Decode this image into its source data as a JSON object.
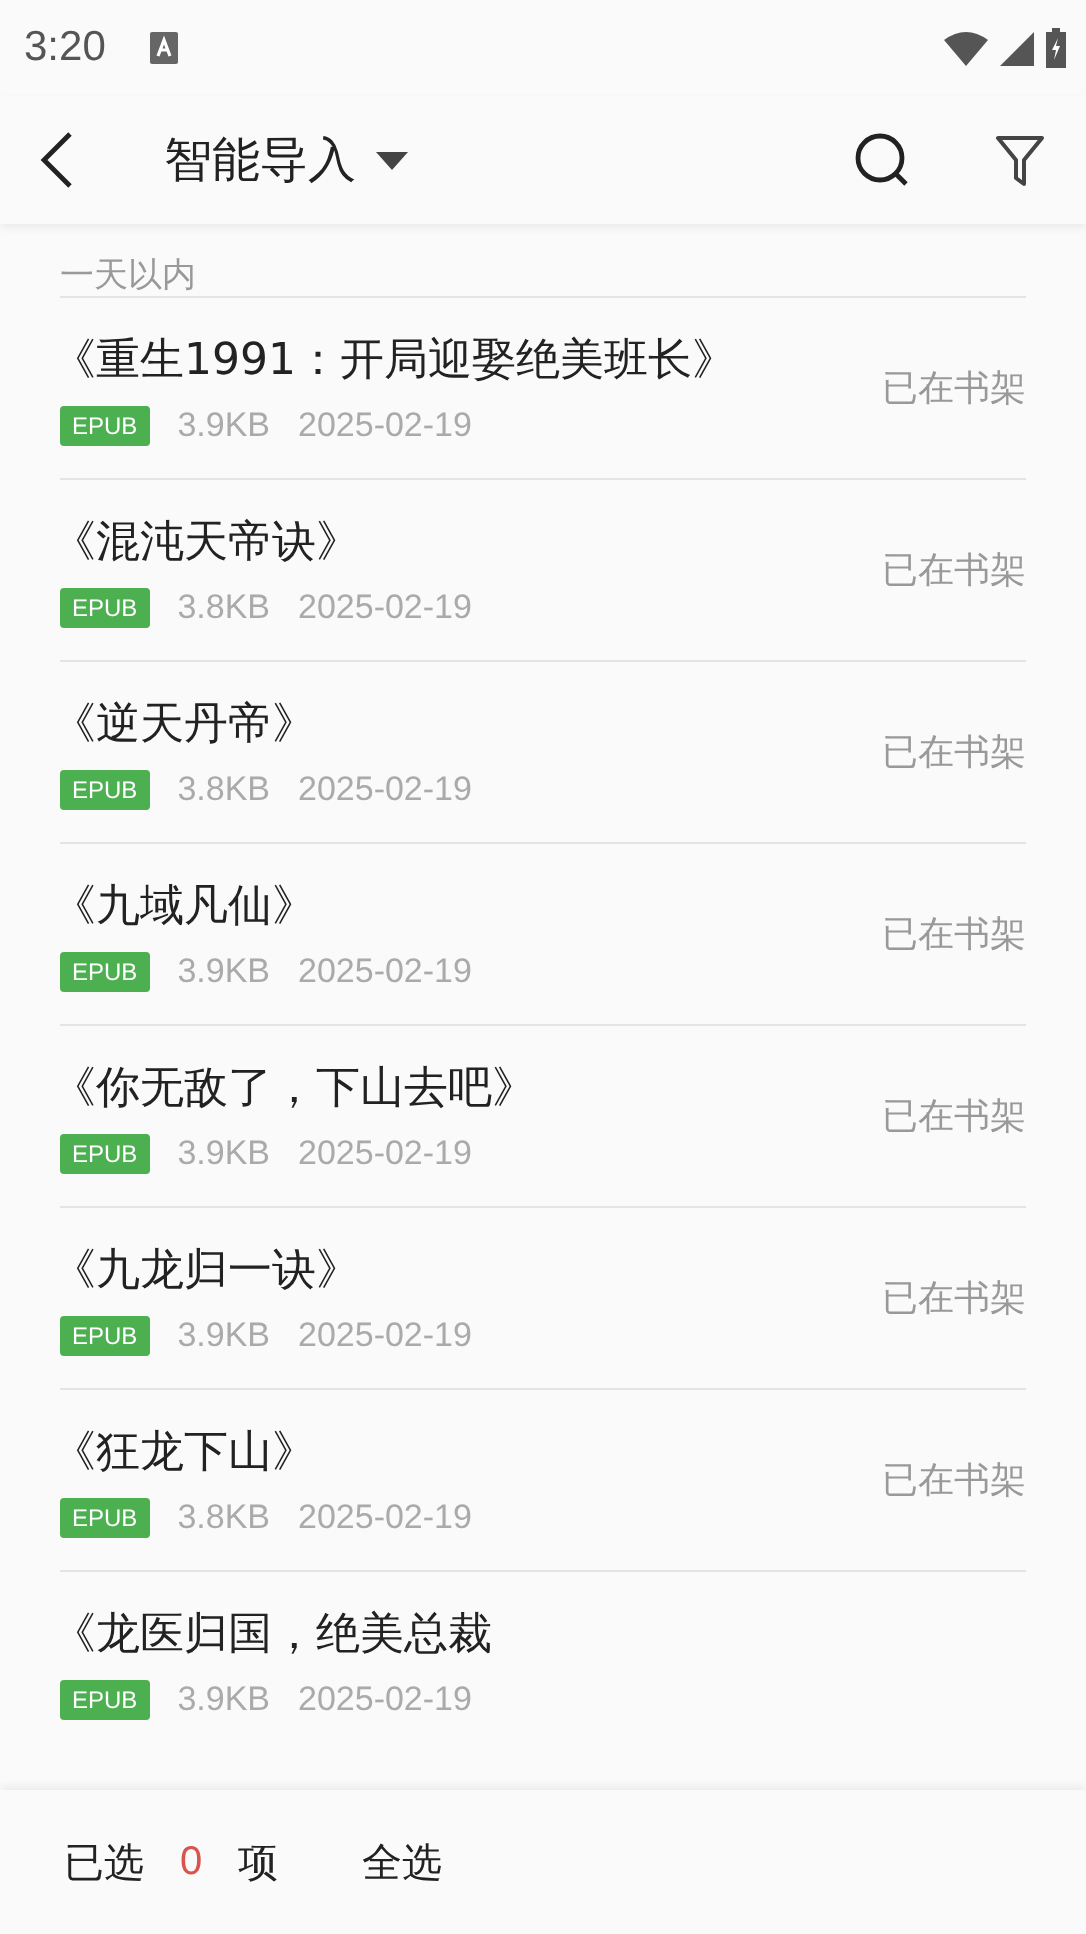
{
  "status_bar": {
    "time": "3:20"
  },
  "app_bar": {
    "title": "智能导入"
  },
  "section": {
    "title": "一天以内"
  },
  "books": [
    {
      "title": "《重生1991：开局迎娶绝美班长》",
      "format": "EPUB",
      "size": "3.9KB",
      "date": "2025-02-19",
      "status": "已在书架"
    },
    {
      "title": "《混沌天帝诀》",
      "format": "EPUB",
      "size": "3.8KB",
      "date": "2025-02-19",
      "status": "已在书架"
    },
    {
      "title": "《逆天丹帝》",
      "format": "EPUB",
      "size": "3.8KB",
      "date": "2025-02-19",
      "status": "已在书架"
    },
    {
      "title": "《九域凡仙》",
      "format": "EPUB",
      "size": "3.9KB",
      "date": "2025-02-19",
      "status": "已在书架"
    },
    {
      "title": "《你无敌了，下山去吧》",
      "format": "EPUB",
      "size": "3.9KB",
      "date": "2025-02-19",
      "status": "已在书架"
    },
    {
      "title": "《九龙归一诀》",
      "format": "EPUB",
      "size": "3.9KB",
      "date": "2025-02-19",
      "status": "已在书架"
    },
    {
      "title": "《狂龙下山》",
      "format": "EPUB",
      "size": "3.8KB",
      "date": "2025-02-19",
      "status": "已在书架"
    },
    {
      "title": "《龙医归国，绝美总裁",
      "format": "EPUB",
      "size": "3.9KB",
      "date": "2025-02-19"
    }
  ],
  "bottom_bar": {
    "selected_prefix": "已选",
    "selected_count": "0",
    "selected_suffix": "项",
    "select_all": "全选"
  }
}
